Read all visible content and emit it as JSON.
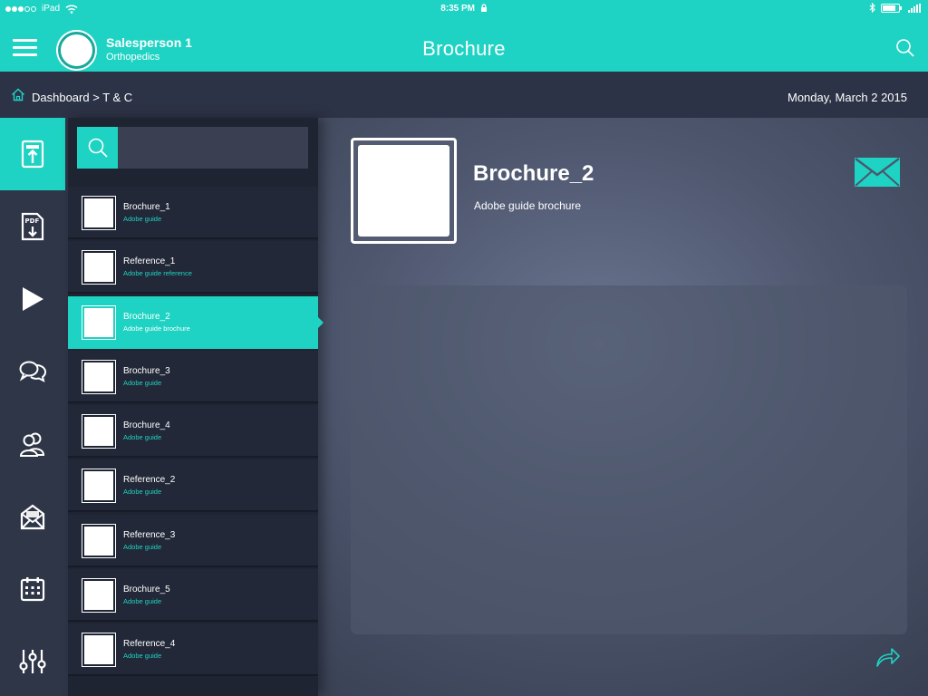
{
  "status_bar": {
    "carrier": "iPad",
    "time": "8:35 PM"
  },
  "header": {
    "user_name": "Salesperson 1",
    "user_role": "Orthopedics",
    "title": "Brochure"
  },
  "breadcrumb": {
    "dashboard": "Dashboard",
    "separator": " > ",
    "current": "T & C",
    "date": "Monday, March 2 2015"
  },
  "rail": {
    "items": [
      {
        "icon": "brochure-upload-icon",
        "active": true
      },
      {
        "icon": "pdf-download-icon",
        "active": false
      },
      {
        "icon": "play-icon",
        "active": false
      },
      {
        "icon": "chat-bubbles-icon",
        "active": false
      },
      {
        "icon": "contacts-icon",
        "active": false
      },
      {
        "icon": "open-mail-icon",
        "active": false
      },
      {
        "icon": "calendar-icon",
        "active": false
      },
      {
        "icon": "sliders-icon",
        "active": false
      }
    ]
  },
  "search": {
    "value": "",
    "placeholder": ""
  },
  "list": {
    "items": [
      {
        "title": "Brochure_1",
        "subtitle": "Adobe guide"
      },
      {
        "title": "Reference_1",
        "subtitle": "Adobe guide reference"
      },
      {
        "title": "Brochure_2",
        "subtitle": "Adobe guide brochure"
      },
      {
        "title": "Brochure_3",
        "subtitle": "Adobe guide"
      },
      {
        "title": "Brochure_4",
        "subtitle": "Adobe guide"
      },
      {
        "title": "Reference_2",
        "subtitle": "Adobe guide"
      },
      {
        "title": "Reference_3",
        "subtitle": "Adobe guide"
      },
      {
        "title": "Brochure_5",
        "subtitle": "Adobe guide"
      },
      {
        "title": "Reference_4",
        "subtitle": "Adobe guide"
      }
    ],
    "selected_index": 2
  },
  "detail": {
    "title": "Brochure_2",
    "subtitle": "Adobe guide brochure"
  },
  "colors": {
    "accent": "#1ed3c3",
    "header_bg": "#1ed3c3",
    "panel_bg": "#1f2433",
    "rail_bg": "#2f3648"
  }
}
